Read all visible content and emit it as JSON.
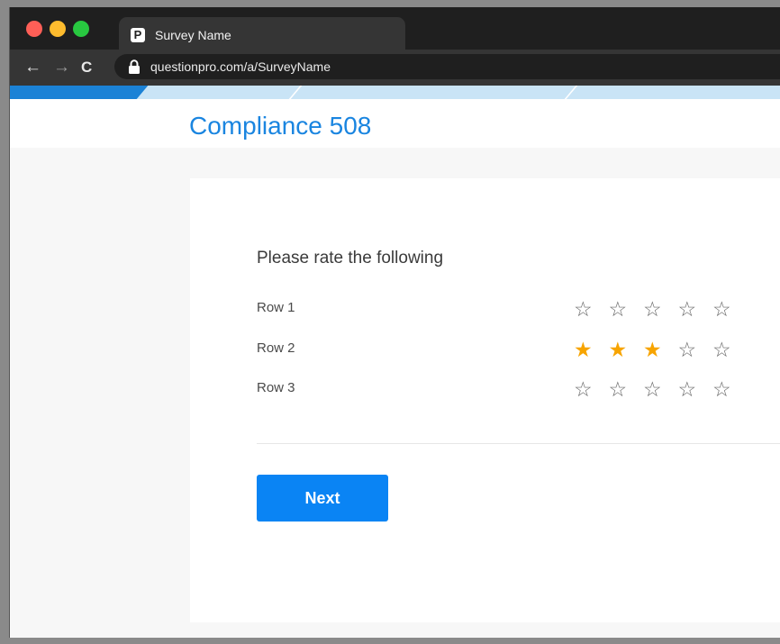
{
  "browser": {
    "tab_title": "Survey Name",
    "favicon_letter": "P",
    "url": "questionpro.com/a/SurveyName",
    "back_icon": "←",
    "forward_icon": "→",
    "reload_icon": "C"
  },
  "survey": {
    "title": "Compliance 508",
    "question": "Please rate the following",
    "rows": [
      {
        "label": "Row 1",
        "rating": 0,
        "max": 5
      },
      {
        "label": "Row 2",
        "rating": 3,
        "max": 5
      },
      {
        "label": "Row 3",
        "rating": 0,
        "max": 5
      }
    ],
    "next_label": "Next",
    "progress": 0.16
  },
  "colors": {
    "accent": "#1a85e0",
    "button": "#0a84f4",
    "star_on": "#f7a400",
    "star_off": "#6a6a6a"
  },
  "icons": {
    "star_filled": "★",
    "star_empty": "☆"
  }
}
